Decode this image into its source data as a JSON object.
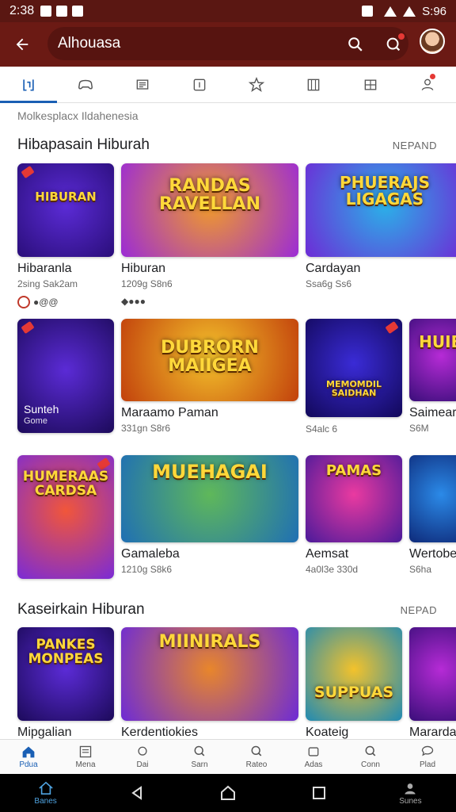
{
  "status_bar": {
    "time": "2:38",
    "battery": "S:96"
  },
  "app_bar": {
    "search_query": "Alhouasa"
  },
  "breadcrumb": "Molkesplacx  Ildahenesia",
  "sections": [
    {
      "title": "Hibapasain Hiburah",
      "more": "NEPAND"
    },
    {
      "title": "Kaseirkain Hiburan",
      "more": "NEPAD"
    }
  ],
  "rows": [
    [
      {
        "title": "Hibaranla",
        "meta": "2sing  Sak2am",
        "extra": "●@@",
        "art": "HIBURAN",
        "colors": [
          "#5b2bd6",
          "#2a0e7a"
        ]
      },
      {
        "title": "Hiburan",
        "meta": "1209g  S8n6",
        "extra": "◆●●●",
        "art": "RANDAS RAVELLAN",
        "colors": [
          "#f09a2b",
          "#9b2bd6"
        ]
      },
      {
        "title": "Cardayan",
        "meta": "Ssa6g  Ss6",
        "art": "PHUERAJS LIGAGAS",
        "colors": [
          "#2bb0e8",
          "#6d2bd6"
        ]
      }
    ],
    [
      {
        "title": "",
        "meta": "",
        "art": "",
        "overlay_title": "Sunteh",
        "overlay_sub": "Gome",
        "colors": [
          "#5b2bd6",
          "#1c0a5a"
        ]
      },
      {
        "title": "Maraamo Paman",
        "meta": "331gn  S8r6",
        "art": "DUBRORN MAIIGEA",
        "colors": [
          "#f3c22b",
          "#c2410c"
        ]
      },
      {
        "title": "",
        "meta": "S4alc  6",
        "art": "MEMOMDIL SAIDHAN",
        "colors": [
          "#3a2bd6",
          "#12085a"
        ]
      },
      {
        "title": "Saimear",
        "meta": "S6M",
        "art": "HUIB",
        "colors": [
          "#b62bd6",
          "#3a0e7a"
        ]
      }
    ],
    [
      {
        "title": "",
        "meta": "",
        "art": "HUMERAAS CARDSA",
        "colors": [
          "#f1563a",
          "#7b2bd6"
        ]
      },
      {
        "title": "Gamaleba",
        "meta": "1210g  S8k6",
        "art": "MUEHAGAI",
        "colors": [
          "#5fb85a",
          "#1f6fb4"
        ]
      },
      {
        "title": "Aemsat",
        "meta": "4a0l3e  330d",
        "art": "PAMAS",
        "colors": [
          "#ea3aa0",
          "#4a1a9a"
        ]
      },
      {
        "title": "Wertobe",
        "meta": "S6ha",
        "art": "",
        "colors": [
          "#2b8ae8",
          "#0e2a7a"
        ]
      }
    ],
    [
      {
        "title": "Mipgalian",
        "meta": "",
        "art": "PANKES MONPEAS",
        "colors": [
          "#5b2bd6",
          "#1c0a5a"
        ]
      },
      {
        "title": "Kerdentiokies",
        "meta": "",
        "art": "MIINIRALS",
        "colors": [
          "#e8862b",
          "#6d2bd6"
        ]
      },
      {
        "title": "Koateig",
        "meta": "",
        "art": "SUPPUAS",
        "colors": [
          "#f3c22b",
          "#1f8ab4"
        ]
      },
      {
        "title": "Marardar",
        "meta": "",
        "art": "",
        "colors": [
          "#b62bd6",
          "#3a0e7a"
        ]
      }
    ]
  ],
  "bottom_nav": [
    {
      "label": "Pdua"
    },
    {
      "label": "Mena"
    },
    {
      "label": "Dai"
    },
    {
      "label": "Sarn"
    },
    {
      "label": "Rateo"
    },
    {
      "label": "Adas"
    },
    {
      "label": "Conn"
    },
    {
      "label": "Plad"
    }
  ],
  "system_nav": {
    "left_label": "Banes",
    "right_label": "Sunes"
  }
}
